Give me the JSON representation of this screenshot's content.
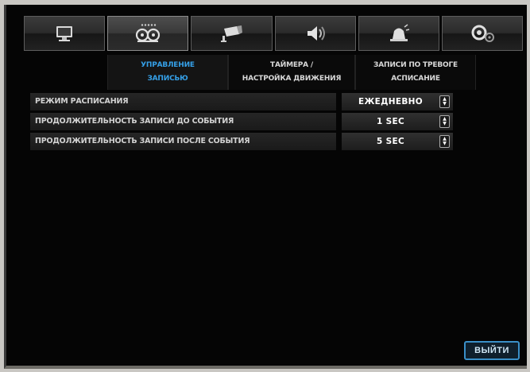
{
  "top_tabs": [
    {
      "icon": "monitor-icon"
    },
    {
      "icon": "recording-icon"
    },
    {
      "icon": "camera-icon"
    },
    {
      "icon": "speaker-icon"
    },
    {
      "icon": "alarm-icon"
    },
    {
      "icon": "settings-icon"
    }
  ],
  "sub_tabs": [
    {
      "line1": "УПРАВЛЕНИЕ",
      "line2": "ЗАПИСЬЮ"
    },
    {
      "line1": "ТАЙМЕРА /",
      "line2": "НАСТРОЙКА ДВИЖЕНИЯ"
    },
    {
      "line1": "ЗАПИСИ ПО ТРЕВОГЕ",
      "line2": "АСПИСАНИЕ"
    }
  ],
  "settings": [
    {
      "label": "РЕЖИМ РАСПИСАНИЯ",
      "value": "ЕЖЕДНЕВНО"
    },
    {
      "label": "ПРОДОЛЖИТЕЛЬНОСТЬ ЗАПИСИ ДО СОБЫТИЯ",
      "value": "1  SEC"
    },
    {
      "label": "ПРОДОЛЖИТЕЛЬНОСТЬ ЗАПИСИ ПОСЛЕ СОБЫТИЯ",
      "value": "5  SEC"
    }
  ],
  "exit_label": "ВЫЙТИ",
  "colors": {
    "active_subtab": "#35a0e8",
    "exit_border": "#3a8fc8",
    "background": "#050505"
  }
}
